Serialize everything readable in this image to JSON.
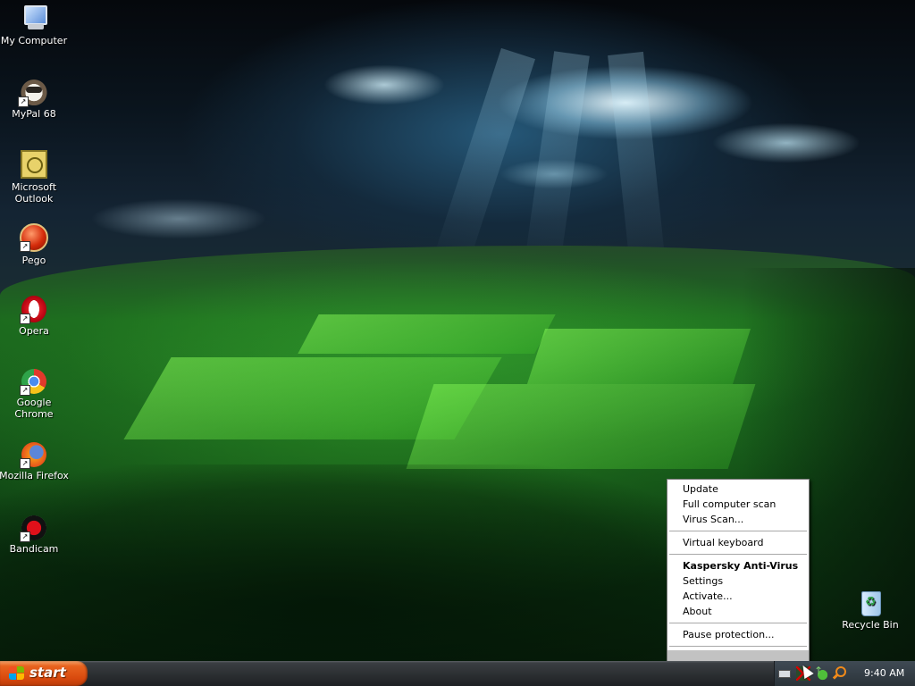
{
  "desktop": {
    "icons": [
      {
        "label": "My Computer",
        "icon": "computer-icon"
      },
      {
        "label": "MyPal 68",
        "icon": "mypal-icon"
      },
      {
        "label": "Microsoft Outlook",
        "icon": "outlook-icon"
      },
      {
        "label": "Pego",
        "icon": "pego-icon"
      },
      {
        "label": "Opera",
        "icon": "opera-icon"
      },
      {
        "label": "Google Chrome",
        "icon": "chrome-icon"
      },
      {
        "label": "Mozilla Firefox",
        "icon": "firefox-icon"
      },
      {
        "label": "Bandicam",
        "icon": "bandicam-icon"
      },
      {
        "label": "Recycle Bin",
        "icon": "recycle-bin-icon"
      }
    ]
  },
  "context_menu": {
    "items": [
      {
        "label": "Update"
      },
      {
        "label": "Full computer scan"
      },
      {
        "label": "Virus Scan..."
      },
      {
        "label": "Virtual keyboard"
      },
      {
        "label": "Kaspersky Anti-Virus",
        "bold": true
      },
      {
        "label": "Settings"
      },
      {
        "label": "Activate..."
      },
      {
        "label": "About"
      },
      {
        "label": "Pause protection..."
      },
      {
        "label": ""
      }
    ]
  },
  "taskbar": {
    "start_label": "start",
    "clock": "9:40 AM",
    "tray_icons": [
      "keyboard-icon",
      "kaspersky-icon",
      "network-icon",
      "search-icon"
    ],
    "accent_color": "#e8641f"
  }
}
